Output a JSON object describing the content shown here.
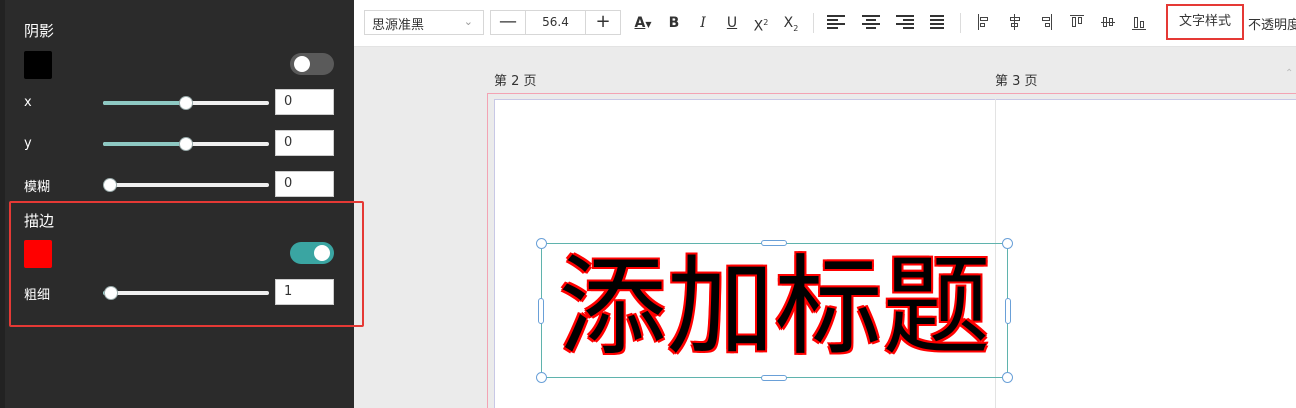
{
  "shadow": {
    "title": "阴影",
    "color": "#000000",
    "enabled": false,
    "x": {
      "label": "x",
      "value": "0",
      "fraction": 0.5
    },
    "y": {
      "label": "y",
      "value": "0",
      "fraction": 0.5
    },
    "blur": {
      "label": "模糊",
      "value": "0",
      "fraction": 0.0
    }
  },
  "stroke": {
    "title": "描边",
    "color": "#ff0000",
    "enabled": true,
    "width": {
      "label": "粗细",
      "value": "1",
      "fraction": 0.05
    }
  },
  "toolbar": {
    "font_family": "思源准黑",
    "font_size": "56.4",
    "minus": "—",
    "plus": "+",
    "font_color_glyph": "A",
    "bold": "B",
    "italic": "I",
    "underline": "U",
    "superscript_base": "X",
    "superscript_mark": "2",
    "subscript_base": "X",
    "subscript_mark": "2",
    "text_style": "文字样式",
    "opacity": "不透明度"
  },
  "canvas": {
    "page2_label": "第 2 页",
    "page3_label": "第 3 页",
    "title_text": "添加标题"
  },
  "colors": {
    "accent_teal": "#3aa5a2",
    "highlight_red": "#e53935"
  },
  "icons": {
    "font_dropdown": "chevron-down-icon",
    "align_left": "align-left-icon",
    "align_center": "align-center-icon",
    "align_right": "align-right-icon",
    "align_justify": "align-justify-icon"
  }
}
